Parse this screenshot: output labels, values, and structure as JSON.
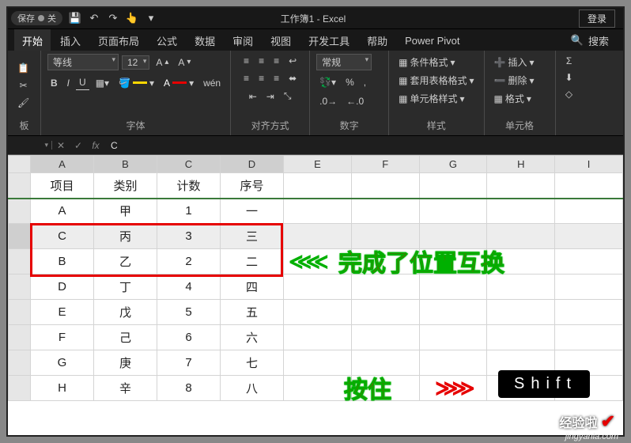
{
  "titlebar": {
    "autosave": "保存",
    "autosave_state": "关",
    "title": "工作簿1 - Excel",
    "login": "登录"
  },
  "tabs": [
    "开始",
    "插入",
    "页面布局",
    "公式",
    "数据",
    "审阅",
    "视图",
    "开发工具",
    "帮助",
    "Power Pivot",
    "搜索"
  ],
  "ribbon": {
    "groups": [
      "板",
      "字体",
      "对齐方式",
      "数字",
      "样式",
      "单元格"
    ],
    "font": {
      "name": "等线",
      "size": "12",
      "bold": "B",
      "italic": "I",
      "underline": "U",
      "wen": "wén"
    },
    "number": {
      "format": "常规",
      "percent": "%",
      "comma": ","
    },
    "styles": {
      "cond": "条件格式",
      "table": "套用表格格式",
      "cell": "单元格样式"
    },
    "cells": {
      "insert": "插入",
      "delete": "删除",
      "format": "格式"
    }
  },
  "formulabar": {
    "namebox": "",
    "cancel": "✕",
    "confirm": "✓",
    "fx": "fx",
    "value": "C"
  },
  "sheet": {
    "cols": [
      "A",
      "B",
      "C",
      "D",
      "E",
      "F",
      "G",
      "H",
      "I"
    ],
    "rows": [
      [
        "项目",
        "类别",
        "计数",
        "序号"
      ],
      [
        "A",
        "甲",
        "1",
        "一"
      ],
      [
        "C",
        "丙",
        "3",
        "三"
      ],
      [
        "B",
        "乙",
        "2",
        "二"
      ],
      [
        "D",
        "丁",
        "4",
        "四"
      ],
      [
        "E",
        "戊",
        "5",
        "五"
      ],
      [
        "F",
        "己",
        "6",
        "六"
      ],
      [
        "G",
        "庚",
        "7",
        "七"
      ],
      [
        "H",
        "辛",
        "8",
        "八"
      ]
    ]
  },
  "annotations": {
    "swap": "完成了位置互换",
    "hold": "按住",
    "shift": "Shift",
    "watermark": "经验啦",
    "url": "jingyanla.com"
  }
}
